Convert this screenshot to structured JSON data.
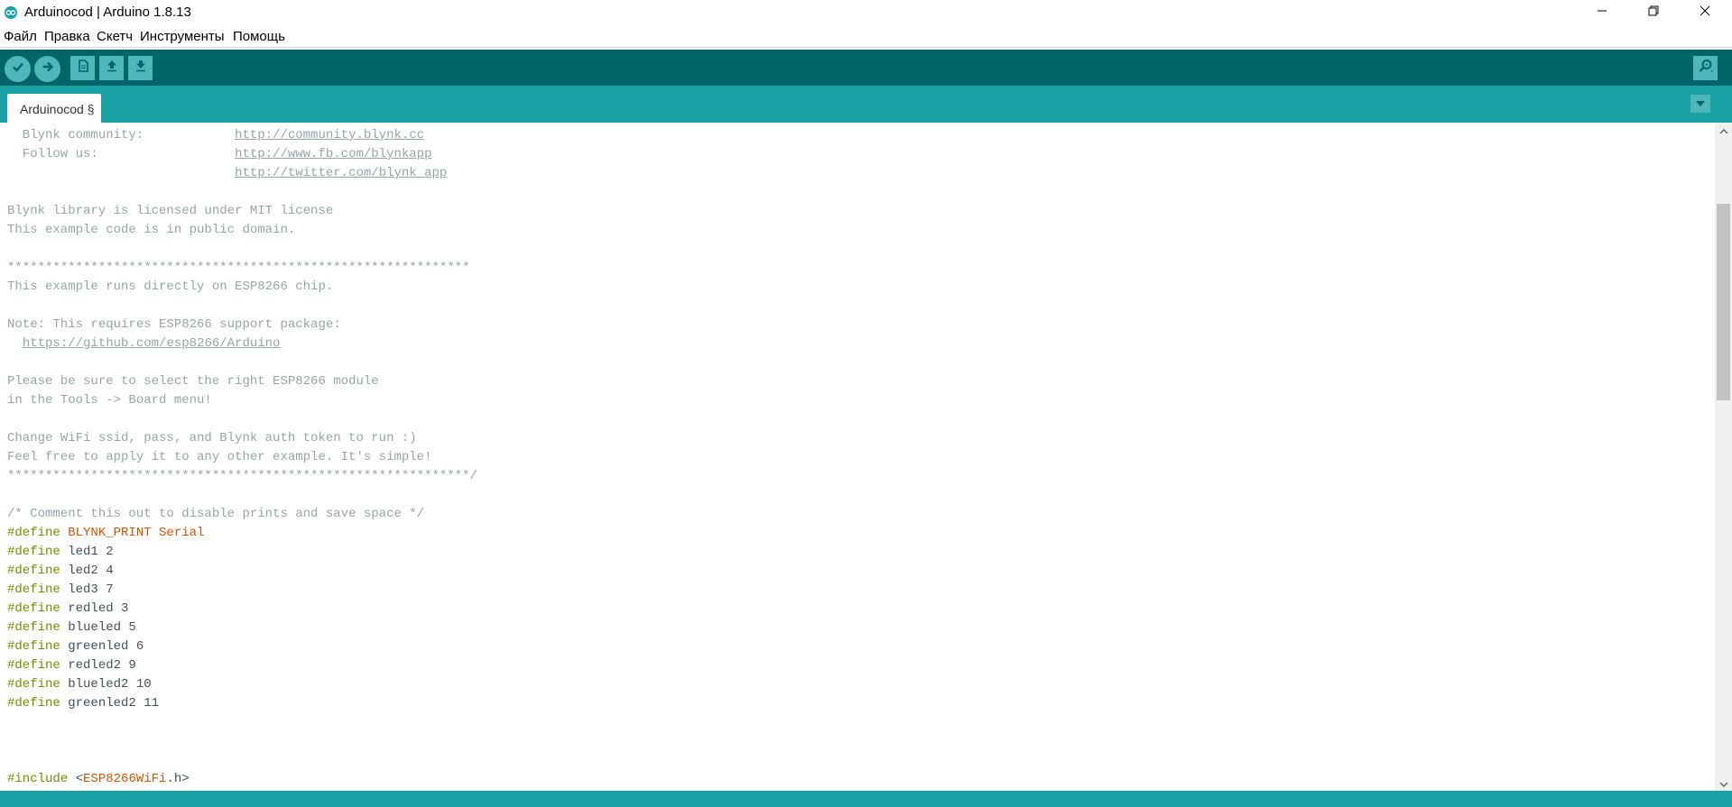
{
  "window": {
    "title": "Arduinocod | Arduino 1.8.13",
    "minimize_icon": "minimize-icon",
    "maximize_icon": "restore-icon",
    "close_icon": "close-icon"
  },
  "menu": {
    "items": [
      "Файл",
      "Правка",
      "Скетч",
      "Инструменты",
      "Помощь"
    ]
  },
  "toolbar": {
    "buttons": [
      "verify-icon",
      "upload-icon",
      "new-sketch-icon",
      "open-sketch-icon",
      "save-sketch-icon"
    ],
    "serial_monitor_icon": "serial-monitor-icon"
  },
  "tabs": {
    "active_label": "Arduinocod §",
    "menu_icon": "chevron-down-icon"
  },
  "editor": {
    "lines": [
      [
        {
          "t": "comment",
          "s": "  Blynk community:            "
        },
        {
          "t": "link",
          "s": "http://community.blynk.cc"
        }
      ],
      [
        {
          "t": "comment",
          "s": "  Follow us:                  "
        },
        {
          "t": "link",
          "s": "http://www.fb.com/blynkapp"
        }
      ],
      [
        {
          "t": "comment",
          "s": "                              "
        },
        {
          "t": "link",
          "s": "http://twitter.com/blynk_app"
        }
      ],
      [],
      [
        {
          "t": "comment",
          "s": "Blynk library is licensed under MIT license"
        }
      ],
      [
        {
          "t": "comment",
          "s": "This example code is in public domain."
        }
      ],
      [],
      [
        {
          "t": "comment",
          "s": "*************************************************************"
        }
      ],
      [
        {
          "t": "comment",
          "s": "This example runs directly on ESP8266 chip."
        }
      ],
      [],
      [
        {
          "t": "comment",
          "s": "Note: This requires ESP8266 support package:"
        }
      ],
      [
        {
          "t": "comment",
          "s": "  "
        },
        {
          "t": "link",
          "s": "https://github.com/esp8266/Arduino"
        }
      ],
      [],
      [
        {
          "t": "comment",
          "s": "Please be sure to select the right ESP8266 module"
        }
      ],
      [
        {
          "t": "comment",
          "s": "in the Tools -> Board menu!"
        }
      ],
      [],
      [
        {
          "t": "comment",
          "s": "Change WiFi ssid, pass, and Blynk auth token to run :)"
        }
      ],
      [
        {
          "t": "comment",
          "s": "Feel free to apply it to any other example. It's simple!"
        }
      ],
      [
        {
          "t": "comment",
          "s": "*************************************************************/"
        }
      ],
      [],
      [
        {
          "t": "comment",
          "s": "/* Comment this out to disable prints and save space */"
        }
      ],
      [
        {
          "t": "directive",
          "s": "#define"
        },
        {
          "t": "keyword",
          "s": " BLYNK_PRINT "
        },
        {
          "t": "keyword",
          "s": "Serial"
        }
      ],
      [
        {
          "t": "directive",
          "s": "#define"
        },
        {
          "t": "plain",
          "s": " led1 2"
        }
      ],
      [
        {
          "t": "directive",
          "s": "#define"
        },
        {
          "t": "plain",
          "s": " led2 4"
        }
      ],
      [
        {
          "t": "directive",
          "s": "#define"
        },
        {
          "t": "plain",
          "s": " led3 7"
        }
      ],
      [
        {
          "t": "directive",
          "s": "#define"
        },
        {
          "t": "plain",
          "s": " redled 3"
        }
      ],
      [
        {
          "t": "directive",
          "s": "#define"
        },
        {
          "t": "plain",
          "s": " blueled 5"
        }
      ],
      [
        {
          "t": "directive",
          "s": "#define"
        },
        {
          "t": "plain",
          "s": " greenled 6"
        }
      ],
      [
        {
          "t": "directive",
          "s": "#define"
        },
        {
          "t": "plain",
          "s": " redled2 9"
        }
      ],
      [
        {
          "t": "directive",
          "s": "#define"
        },
        {
          "t": "plain",
          "s": " blueled2 10"
        }
      ],
      [
        {
          "t": "directive",
          "s": "#define"
        },
        {
          "t": "plain",
          "s": " greenled2 11"
        }
      ],
      [],
      [],
      [],
      [
        {
          "t": "directive",
          "s": "#include"
        },
        {
          "t": "plain",
          "s": " <"
        },
        {
          "t": "keyword",
          "s": "ESP8266WiFi"
        },
        {
          "t": "plain",
          "s": ".h>"
        }
      ]
    ]
  },
  "scrollbar": {
    "up_icon": "scroll-up-arrow-icon",
    "down_icon": "scroll-down-arrow-icon"
  },
  "colors": {
    "toolbar": "#006468",
    "tabbar": "#17a1a5",
    "button": "#4db7bb",
    "comment": "#95a5a6",
    "directive": "#728e00",
    "keyword": "#d35400",
    "plain": "#434f54"
  }
}
